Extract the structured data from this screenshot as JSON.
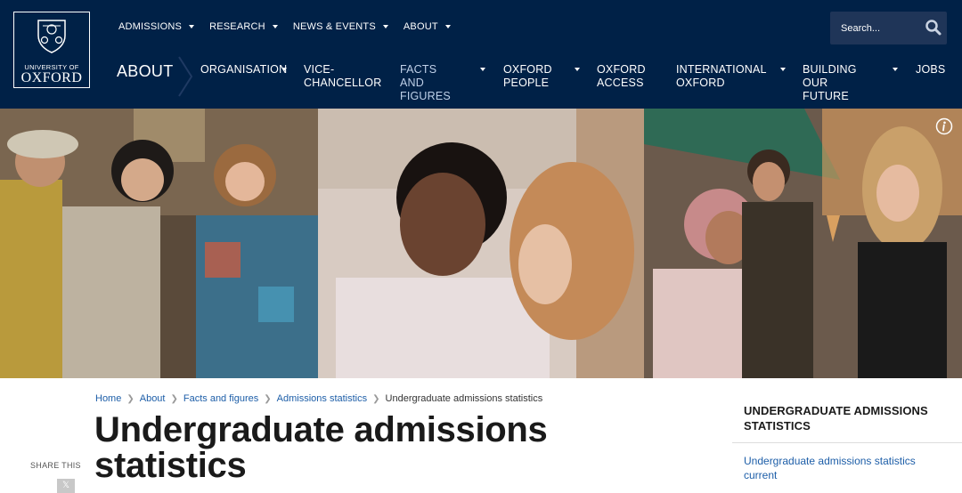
{
  "logo": {
    "line1": "UNIVERSITY OF",
    "line2": "OXFORD"
  },
  "topnav": [
    {
      "label": "ADMISSIONS"
    },
    {
      "label": "RESEARCH"
    },
    {
      "label": "NEWS & EVENTS"
    },
    {
      "label": "ABOUT"
    }
  ],
  "search": {
    "placeholder": "Search..."
  },
  "section": {
    "title": "ABOUT"
  },
  "mainnav": [
    {
      "label": "ORGANISATION"
    },
    {
      "label": "VICE-\nCHANCELLOR"
    },
    {
      "label": "FACTS AND\nFIGURES"
    },
    {
      "label": "OXFORD\nPEOPLE"
    },
    {
      "label": "OXFORD\nACCESS"
    },
    {
      "label": "INTERNATIONAL\nOXFORD"
    },
    {
      "label": "BUILDING OUR\nFUTURE"
    },
    {
      "label": "JOBS"
    }
  ],
  "breadcrumb": [
    {
      "label": "Home"
    },
    {
      "label": "About"
    },
    {
      "label": "Facts and figures"
    },
    {
      "label": "Admissions statistics"
    },
    {
      "label": "Undergraduate admissions statistics"
    }
  ],
  "page": {
    "title": "Undergraduate admissions statistics"
  },
  "share": {
    "label": "SHARE THIS"
  },
  "sidebar": {
    "title": "UNDERGRADUATE ADMISSIONS STATISTICS",
    "link": "Undergraduate admissions statistics current"
  },
  "colors": {
    "navy": "#002147",
    "link": "#1d5ea8"
  },
  "icons": {
    "search": "search-icon",
    "info": "info-icon",
    "x": "x-logo-icon"
  }
}
